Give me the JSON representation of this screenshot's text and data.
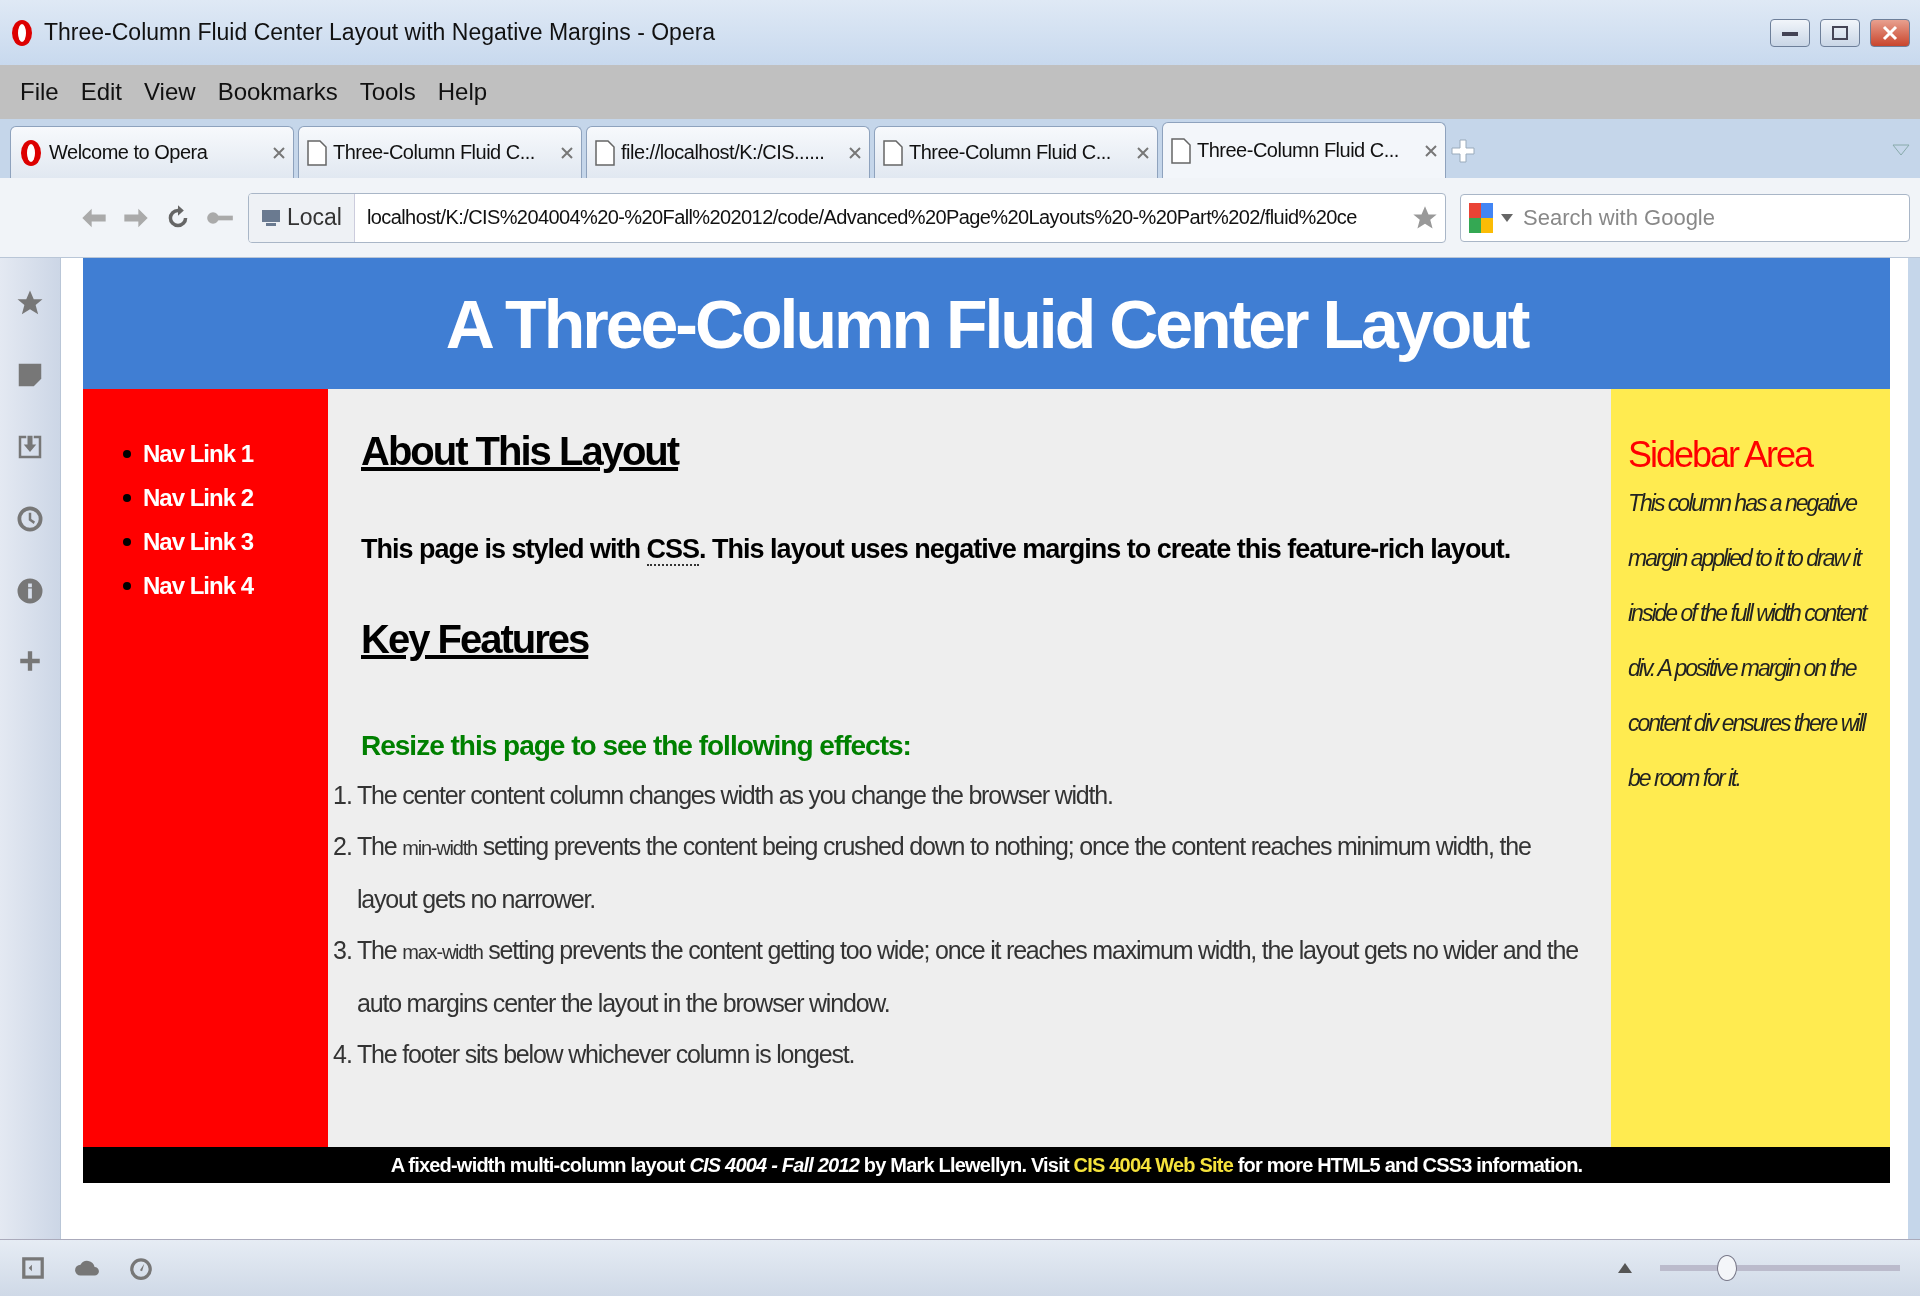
{
  "window": {
    "title": "Three-Column Fluid Center Layout with Negative Margins - Opera"
  },
  "menu": [
    "File",
    "Edit",
    "View",
    "Bookmarks",
    "Tools",
    "Help"
  ],
  "tabs": [
    {
      "label": "Welcome to Opera",
      "kind": "opera",
      "selected": false
    },
    {
      "label": "Three-Column Fluid C...",
      "kind": "page",
      "selected": false
    },
    {
      "label": "file://localhost/K:/CIS......",
      "kind": "page",
      "selected": false
    },
    {
      "label": "Three-Column Fluid C...",
      "kind": "page",
      "selected": false
    },
    {
      "label": "Three-Column Fluid C...",
      "kind": "page",
      "selected": true
    }
  ],
  "address": {
    "badge": "Local",
    "url": "localhost/K:/CIS%204004%20-%20Fall%202012/code/Advanced%20Page%20Layouts%20-%20Part%202/fluid%20ce"
  },
  "search": {
    "placeholder": "Search with Google"
  },
  "page": {
    "header": "A Three-Column Fluid Center Layout",
    "nav": [
      "Nav Link 1",
      "Nav Link 2",
      "Nav Link 3",
      "Nav Link 4"
    ],
    "effect_numbers": [
      "1.",
      "2.",
      "3.",
      "4."
    ],
    "about_heading": "About This Layout",
    "intro": [
      {
        "kind": "plain",
        "text": "This page is styled with "
      },
      {
        "kind": "abbr",
        "text": "CSS"
      },
      {
        "kind": "plain",
        "text": ". This layout uses negative margins to create this feature-rich layout."
      }
    ],
    "features_heading": "Key Features",
    "effects_heading": "Resize this page to see the following effects:",
    "effects": [
      [
        {
          "kind": "plain",
          "text": "The center content column changes width as you change the browser width."
        }
      ],
      [
        {
          "kind": "plain",
          "text": "The "
        },
        {
          "kind": "code",
          "text": "min-width"
        },
        {
          "kind": "plain",
          "text": " setting prevents the content being crushed down to nothing; once the content reaches minimum width, the layout gets no narrower."
        }
      ],
      [
        {
          "kind": "plain",
          "text": "The "
        },
        {
          "kind": "code",
          "text": "max-width"
        },
        {
          "kind": "plain",
          "text": " setting prevents the content getting too wide; once it reaches maximum width, the layout gets no wider and the auto margins center the layout in the browser window."
        }
      ],
      [
        {
          "kind": "plain",
          "text": "The footer sits below whichever column is longest."
        }
      ]
    ],
    "sidebar": {
      "heading": "Sidebar Area",
      "text": "This column has a negative margin applied to it to draw it inside of the full width content div. A positive margin on the content div ensures there will be room for it."
    },
    "footer": [
      {
        "kind": "plain",
        "text": "A fixed-width multi-column layout "
      },
      {
        "kind": "italic",
        "text": "CIS 4004 - Fall 2012"
      },
      {
        "kind": "plain",
        "text": " by Mark Llewellyn. Visit "
      },
      {
        "kind": "link",
        "text": "CIS 4004 Web Site"
      },
      {
        "kind": "plain",
        "text": " for more HTML5 and CSS3 information."
      }
    ]
  },
  "status_bar": {
    "zoom": {
      "level": 0.28
    }
  }
}
